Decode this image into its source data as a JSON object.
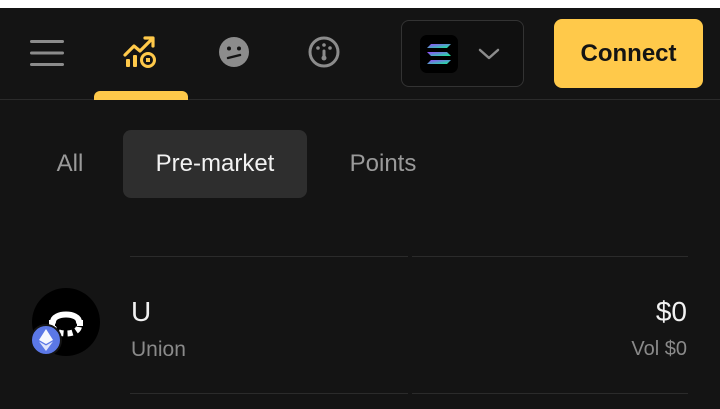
{
  "header": {
    "icons": {
      "menu": "hamburger-menu-icon",
      "markets": "chart-trending-up-icon",
      "mood": "confused-face-icon",
      "dashboard": "gauge-icon"
    },
    "chain_selector": {
      "chain_icon": "solana-logo-icon",
      "chevron": "chevron-down-icon"
    },
    "connect_label": "Connect"
  },
  "tabs": [
    {
      "label": "All",
      "active": false
    },
    {
      "label": "Pre-market",
      "active": true
    },
    {
      "label": "Points",
      "active": false
    }
  ],
  "markets": [
    {
      "symbol": "U",
      "name": "Union",
      "price": "$0",
      "volume": "Vol $0",
      "chain_badge": "ethereum-icon"
    }
  ],
  "colors": {
    "background": "#141414",
    "accent": "#ffc94a",
    "active_tab_bg": "#2e2e2e",
    "muted_text": "#8a8a8a",
    "eth_badge": "#5b78e6"
  }
}
